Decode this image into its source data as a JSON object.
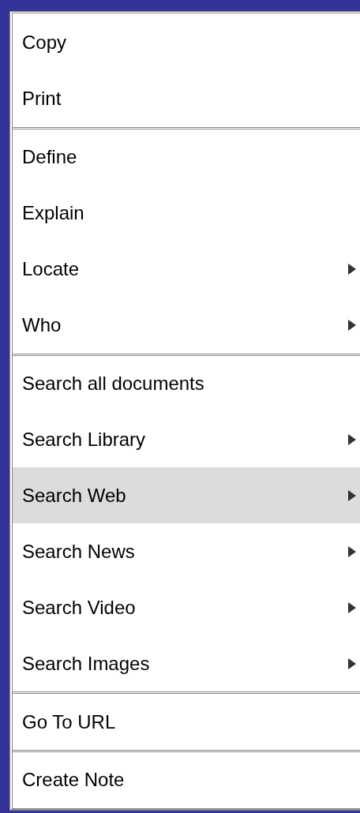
{
  "menu": {
    "sections": [
      {
        "items": [
          {
            "label": "Copy",
            "submenu": false,
            "selected": false
          },
          {
            "label": "Print",
            "submenu": false,
            "selected": false
          }
        ]
      },
      {
        "items": [
          {
            "label": "Define",
            "submenu": false,
            "selected": false
          },
          {
            "label": "Explain",
            "submenu": false,
            "selected": false
          },
          {
            "label": "Locate",
            "submenu": true,
            "selected": false
          },
          {
            "label": "Who",
            "submenu": true,
            "selected": false
          }
        ]
      },
      {
        "items": [
          {
            "label": "Search all documents",
            "submenu": false,
            "selected": false
          },
          {
            "label": "Search Library",
            "submenu": true,
            "selected": false
          },
          {
            "label": "Search Web",
            "submenu": true,
            "selected": true
          },
          {
            "label": "Search News",
            "submenu": true,
            "selected": false
          },
          {
            "label": "Search Video",
            "submenu": true,
            "selected": false
          },
          {
            "label": "Search Images",
            "submenu": true,
            "selected": false
          }
        ]
      },
      {
        "items": [
          {
            "label": "Go To URL",
            "submenu": false,
            "selected": false
          }
        ]
      },
      {
        "items": [
          {
            "label": "Create Note",
            "submenu": false,
            "selected": false
          }
        ]
      }
    ]
  }
}
